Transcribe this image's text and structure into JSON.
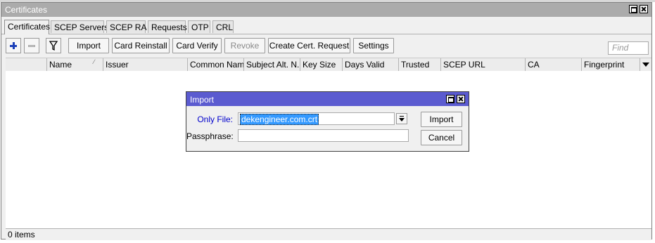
{
  "window": {
    "title": "Certificates"
  },
  "tabs": [
    {
      "label": "Certificates",
      "active": true
    },
    {
      "label": "SCEP Servers"
    },
    {
      "label": "SCEP RA"
    },
    {
      "label": "Requests"
    },
    {
      "label": "OTP"
    },
    {
      "label": "CRL"
    }
  ],
  "toolbar": {
    "add_icon": "plus-icon",
    "remove_icon": "minus-icon",
    "filter_icon": "filter-icon",
    "import_label": "Import",
    "card_reinstall_label": "Card Reinstall",
    "card_verify_label": "Card Verify",
    "revoke_label": "Revoke",
    "create_cert_request_label": "Create Cert. Request",
    "settings_label": "Settings",
    "find_placeholder": "Find"
  },
  "columns": [
    "Name",
    "Issuer",
    "Common Name",
    "Subject Alt. N...",
    "Key Size",
    "Days Valid",
    "Trusted",
    "SCEP URL",
    "CA",
    "Fingerprint"
  ],
  "status": {
    "items": "0 items"
  },
  "dialog": {
    "title": "Import",
    "only_file_label": "Only File:",
    "only_file_value": "dekengineer.com.crt",
    "passphrase_label": "Passphrase:",
    "passphrase_value": "",
    "import_label": "Import",
    "cancel_label": "Cancel"
  },
  "colors": {
    "dialog_title": "#5b5bd0",
    "accent_blue": "#1a3fb8",
    "label_blue": "#0000cc"
  }
}
